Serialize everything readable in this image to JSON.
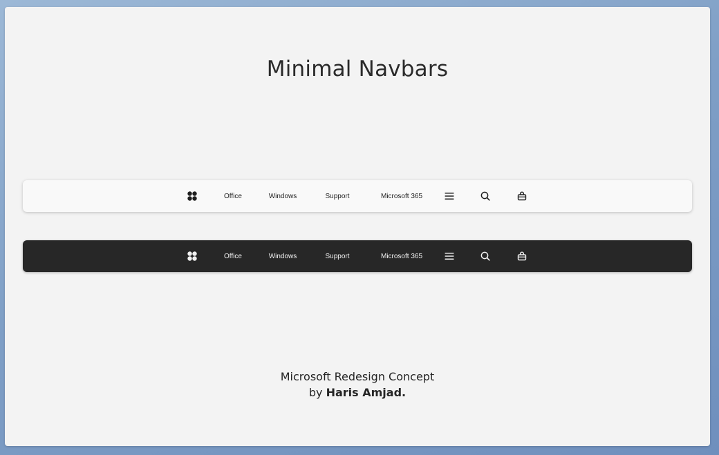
{
  "page": {
    "title": "Minimal Navbars"
  },
  "navbar_light": {
    "theme_color": "#f9f9f9",
    "text_color": "#1f1f1f",
    "logo_icon": "microsoft-logo-icon",
    "links": [
      "Office",
      "Windows",
      "Support",
      "Microsoft 365"
    ],
    "menu_icon": "hamburger-menu-icon",
    "search_icon": "search-icon",
    "cart_icon": "shopping-bag-icon"
  },
  "navbar_dark": {
    "theme_color": "#272727",
    "text_color": "#f2f2f2",
    "logo_icon": "microsoft-logo-icon",
    "links": [
      "Office",
      "Windows",
      "Support",
      "Microsoft 365"
    ],
    "menu_icon": "hamburger-menu-icon",
    "search_icon": "search-icon",
    "cart_icon": "shopping-bag-icon"
  },
  "footer": {
    "line1": "Microsoft Redesign Concept",
    "by_prefix": "by",
    "author": "Haris Amjad."
  },
  "colors": {
    "card_background": "#f3f3f3",
    "desktop_background": "#7f9fc6"
  }
}
